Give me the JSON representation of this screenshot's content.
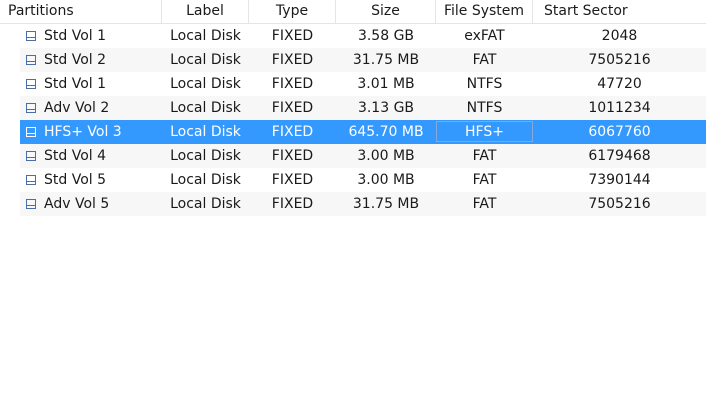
{
  "columns": {
    "partitions": "Partitions",
    "label": "Label",
    "type": "Type",
    "size": "Size",
    "file_system": "File System",
    "start_sector": "Start Sector"
  },
  "icons": {
    "row_icon": "disk-icon",
    "normal_color": "#4a6fa5",
    "selected_color": "#ffffff"
  },
  "colors": {
    "selection": "#3399ff",
    "alt_row": "#f7f7f7"
  },
  "selected_row": 4,
  "rows": [
    {
      "partition": "Std Vol 1",
      "label": "Local Disk",
      "type": "FIXED",
      "size": "3.58 GB",
      "file_system": "exFAT",
      "start_sector": "2048"
    },
    {
      "partition": "Std Vol 2",
      "label": "Local Disk",
      "type": "FIXED",
      "size": "31.75 MB",
      "file_system": "FAT",
      "start_sector": "7505216"
    },
    {
      "partition": "Std Vol 1",
      "label": "Local Disk",
      "type": "FIXED",
      "size": "3.01 MB",
      "file_system": "NTFS",
      "start_sector": "47720"
    },
    {
      "partition": "Adv Vol 2",
      "label": "Local Disk",
      "type": "FIXED",
      "size": "3.13 GB",
      "file_system": "NTFS",
      "start_sector": "1011234"
    },
    {
      "partition": "HFS+ Vol 3",
      "label": "Local Disk",
      "type": "FIXED",
      "size": "645.70 MB",
      "file_system": "HFS+",
      "start_sector": "6067760"
    },
    {
      "partition": "Std Vol 4",
      "label": "Local Disk",
      "type": "FIXED",
      "size": "3.00 MB",
      "file_system": "FAT",
      "start_sector": "6179468"
    },
    {
      "partition": "Std Vol 5",
      "label": "Local Disk",
      "type": "FIXED",
      "size": "3.00 MB",
      "file_system": "FAT",
      "start_sector": "7390144"
    },
    {
      "partition": "Adv Vol 5",
      "label": "Local Disk",
      "type": "FIXED",
      "size": "31.75 MB",
      "file_system": "FAT",
      "start_sector": "7505216"
    }
  ]
}
